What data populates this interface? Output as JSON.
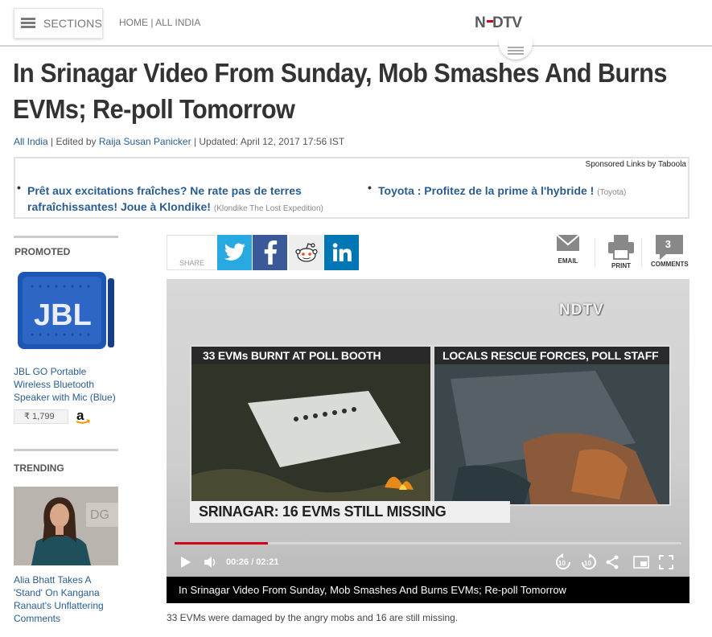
{
  "header": {
    "sections_label": "SECTIONS",
    "breadcrumb": "HOME | ALL INDIA",
    "logo_nd": "ND",
    "logo_tv": "TV",
    "logo_red_char": "•"
  },
  "article": {
    "headline": "In Srinagar Video From Sunday, Mob Smashes And Burns EVMs; Re-poll Tomorrow",
    "byline_section": "All India",
    "byline_sep1": " | Edited by ",
    "byline_editor": "Raija Susan Panicker",
    "byline_updated": " | Updated: April 12, 2017 17:56 IST",
    "summary": "33 EVMs were damaged by the angry mobs and 16 are still missing."
  },
  "sponsored": {
    "label": "Sponsored Links by Taboola",
    "items": [
      {
        "title": "Prêt aux excitations fraîches? Ne rate pas de terres rafraîchissantes! Joue à Klondike!",
        "source": "(Klondike The Lost Expedition)"
      },
      {
        "title": "Toyota : Profitez de la prime à l'hybride !",
        "source": "(Toyota)"
      }
    ]
  },
  "sidebar": {
    "promoted_label": "PROMOTED",
    "product_title": "JBL GO Portable Wireless Bluetooth Speaker with Mic (Blue)",
    "product_price": "₹ 1,799",
    "trending_label": "TRENDING",
    "trending_title": "Alia Bhatt Takes A 'Stand' On Kangana Ranaut's Unflattering Comments"
  },
  "share": {
    "label": "SHARE",
    "email_label": "EMAIL",
    "print_label": "PRINT",
    "comments_label": "COMMENTS",
    "comments_count": "3"
  },
  "video": {
    "watermark": "NDTV",
    "left_caption": "33 EVMs BURNT AT POLL BOOTH",
    "right_caption": "LOCALS RESCUE FORCES, POLL STAFF",
    "ticker": "SRINAGAR: 16 EVMs STILL MISSING",
    "time": "00:26 / 02:21",
    "progress": 0.184,
    "caption": "In Srinagar Video From Sunday, Mob Smashes And Burns EVMs; Re-poll Tomorrow"
  },
  "colors": {
    "link_blue": "#2a5d8f",
    "brand_red": "#d0021b",
    "twitter": "#29a9e1",
    "facebook": "#3b5998",
    "linkedin": "#0077b5"
  }
}
